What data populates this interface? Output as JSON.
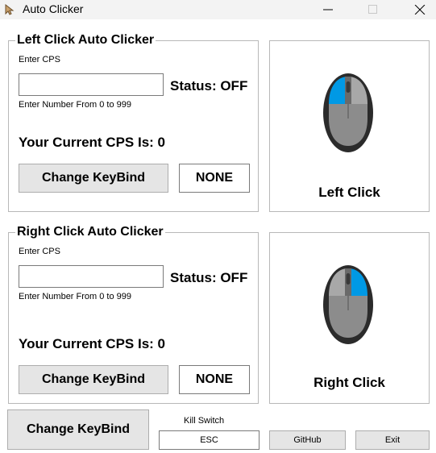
{
  "window": {
    "title": "Auto Clicker"
  },
  "left_panel": {
    "legend": "Left Click Auto Clicker",
    "cps_label": "Enter CPS",
    "cps_value": "",
    "hint": "Enter Number From 0 to 999",
    "status": "Status: OFF",
    "current_cps": "Your Current CPS Is: 0",
    "keybind_button": "Change KeyBind",
    "keybind_value": "NONE"
  },
  "left_mouse": {
    "label": "Left Click",
    "highlight": "left",
    "accent": "#0099e5"
  },
  "right_panel": {
    "legend": "Right Click Auto Clicker",
    "cps_label": "Enter CPS",
    "cps_value": "",
    "hint": "Enter Number From 0 to 999",
    "status": "Status: OFF",
    "current_cps": "Your Current CPS Is: 0",
    "keybind_button": "Change KeyBind",
    "keybind_value": "NONE"
  },
  "right_mouse": {
    "label": "Right Click",
    "highlight": "right",
    "accent": "#0099e5"
  },
  "footer": {
    "kill_button": "Change KeyBind",
    "kill_label": "Kill Switch",
    "kill_key": "ESC",
    "github": "GitHub",
    "exit": "Exit"
  }
}
